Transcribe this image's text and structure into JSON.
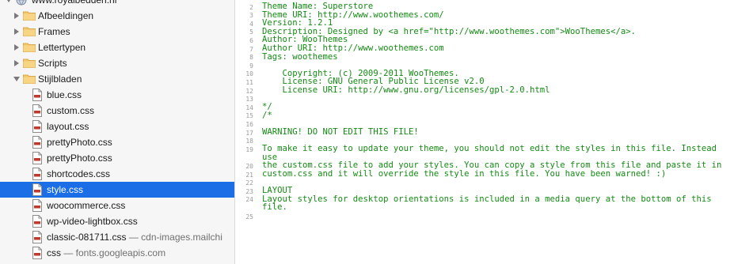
{
  "sidebar": {
    "root": {
      "label": "www.royalbedden.nl",
      "expanded": true,
      "icon": "globe-icon"
    },
    "folders": [
      {
        "label": "Afbeeldingen",
        "expanded": false,
        "icon": "folder-icon"
      },
      {
        "label": "Frames",
        "expanded": false,
        "icon": "folder-icon"
      },
      {
        "label": "Lettertypen",
        "expanded": false,
        "icon": "folder-icon"
      },
      {
        "label": "Scripts",
        "expanded": false,
        "icon": "folder-icon"
      },
      {
        "label": "Stijlbladen",
        "expanded": true,
        "icon": "folder-icon"
      }
    ],
    "files": [
      {
        "label": "blue.css",
        "sub": "",
        "selected": false
      },
      {
        "label": "custom.css",
        "sub": "",
        "selected": false
      },
      {
        "label": "layout.css",
        "sub": "",
        "selected": false
      },
      {
        "label": "prettyPhoto.css",
        "sub": "",
        "selected": false
      },
      {
        "label": "prettyPhoto.css",
        "sub": "",
        "selected": false
      },
      {
        "label": "shortcodes.css",
        "sub": "",
        "selected": false
      },
      {
        "label": "style.css",
        "sub": "",
        "selected": true
      },
      {
        "label": "woocommerce.css",
        "sub": "",
        "selected": false
      },
      {
        "label": "wp-video-lightbox.css",
        "sub": "",
        "selected": false
      },
      {
        "label": "classic-081711.css",
        "sub": " — cdn-images.mailchi",
        "selected": false
      },
      {
        "label": "css",
        "sub": " — fonts.googleapis.com",
        "selected": false
      }
    ],
    "selected_color": "#1b6ee5",
    "folder_color": "#f2c86b"
  },
  "editor": {
    "text_color": "#148a14",
    "lines": [
      {
        "num": "2",
        "text": "Theme Name: Superstore"
      },
      {
        "num": "3",
        "text": "Theme URI: http://www.woothemes.com/"
      },
      {
        "num": "4",
        "text": "Version: 1.2.1"
      },
      {
        "num": "5",
        "text": "Description: Designed by <a href=\"http://www.woothemes.com\">WooThemes</a>."
      },
      {
        "num": "6",
        "text": "Author: WooThemes"
      },
      {
        "num": "7",
        "text": "Author URI: http://www.woothemes.com"
      },
      {
        "num": "8",
        "text": "Tags: woothemes"
      },
      {
        "num": "9",
        "text": ""
      },
      {
        "num": "10",
        "text": "    Copyright: (c) 2009-2011 WooThemes."
      },
      {
        "num": "11",
        "text": "    License: GNU General Public License v2.0"
      },
      {
        "num": "12",
        "text": "    License URI: http://www.gnu.org/licenses/gpl-2.0.html"
      },
      {
        "num": "13",
        "text": ""
      },
      {
        "num": "14",
        "text": "*/"
      },
      {
        "num": "15",
        "text": "/*"
      },
      {
        "num": "16",
        "text": ""
      },
      {
        "num": "17",
        "text": "WARNING! DO NOT EDIT THIS FILE!"
      },
      {
        "num": "18",
        "text": ""
      },
      {
        "num": "19",
        "text": "To make it easy to update your theme, you should not edit the styles in this file. Instead"
      },
      {
        "num": "",
        "text": "use"
      },
      {
        "num": "20",
        "text": "the custom.css file to add your styles. You can copy a style from this file and paste it in"
      },
      {
        "num": "21",
        "text": "custom.css and it will override the style in this file. You have been warned! :)"
      },
      {
        "num": "22",
        "text": ""
      },
      {
        "num": "23",
        "text": "LAYOUT"
      },
      {
        "num": "24",
        "text": "Layout styles for desktop orientations is included in a media query at the bottom of this"
      },
      {
        "num": "",
        "text": "file."
      },
      {
        "num": "25",
        "text": ""
      }
    ]
  }
}
